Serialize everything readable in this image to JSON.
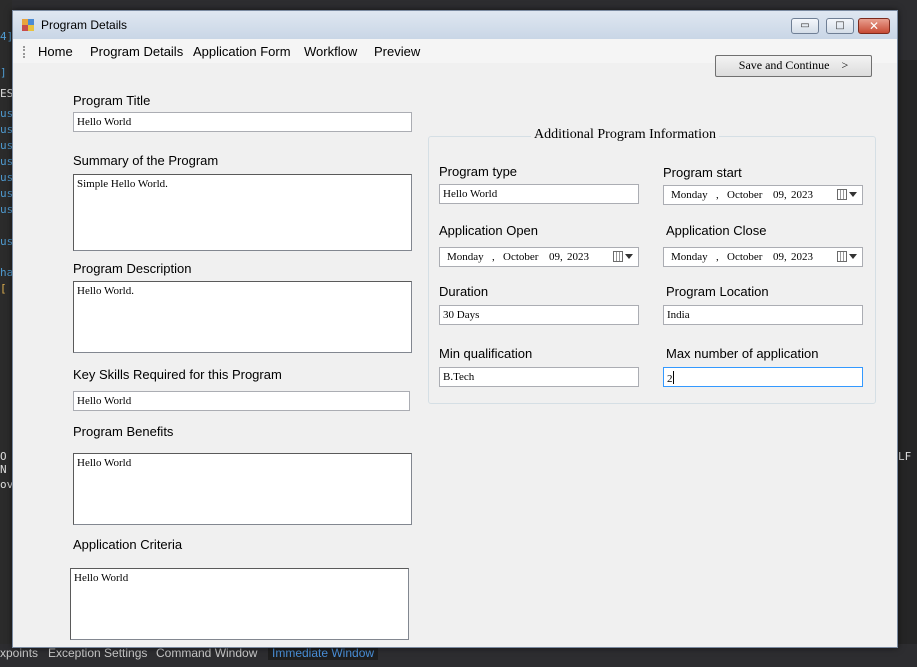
{
  "background": {
    "bottom_tabs": [
      "xpoints",
      "Exception Settings",
      "Command Window",
      "Immediate Window"
    ],
    "left_tokens": [
      "4]",
      "]",
      "ES",
      "us",
      "us",
      "us",
      "us",
      "us",
      "us",
      "us",
      "us",
      "ha",
      "[",
      "O N",
      "ov"
    ],
    "right_tokens": [
      "LF"
    ]
  },
  "window": {
    "title": "Program Details",
    "controls": {
      "minimize": "▭",
      "maximize": "□",
      "close": "✕"
    }
  },
  "menu": [
    "Home",
    "Program Details",
    "Application Form",
    "Workflow",
    "Preview"
  ],
  "save_button": {
    "label": "Save and Continue",
    "arrow": ">"
  },
  "left_form": {
    "program_title": {
      "label": "Program Title",
      "value": "Hello World"
    },
    "summary": {
      "label": "Summary of the Program",
      "value": "Simple Hello World."
    },
    "description": {
      "label": "Program Description",
      "value": "Hello World."
    },
    "key_skills": {
      "label": "Key Skills Required for this Program",
      "value": "Hello World"
    },
    "benefits": {
      "label": "Program Benefits",
      "value": "Hello World"
    },
    "criteria": {
      "label": "Application Criteria",
      "value": "Hello World"
    }
  },
  "additional": {
    "title": "Additional Program Information",
    "program_type": {
      "label": "Program type",
      "value": "Hello World"
    },
    "program_start": {
      "label": "Program start",
      "weekday": "Monday",
      "month": "October",
      "day": "09,",
      "year": "2023"
    },
    "application_open": {
      "label": "Application Open",
      "weekday": "Monday",
      "month": "October",
      "day": "09,",
      "year": "2023"
    },
    "application_close": {
      "label": "Application Close",
      "weekday": "Monday",
      "month": "October",
      "day": "09,",
      "year": "2023"
    },
    "duration": {
      "label": "Duration",
      "value": "30 Days"
    },
    "location": {
      "label": "Program Location",
      "value": "India"
    },
    "min_qualification": {
      "label": "Min qualification",
      "value": "B.Tech"
    },
    "max_applications": {
      "label": "Max number of application",
      "value": "2"
    },
    "date_separator": ","
  },
  "colors": {
    "focus_border": "#3399ff",
    "close_button": "#c74a34",
    "ide_background": "#2d2d30"
  }
}
